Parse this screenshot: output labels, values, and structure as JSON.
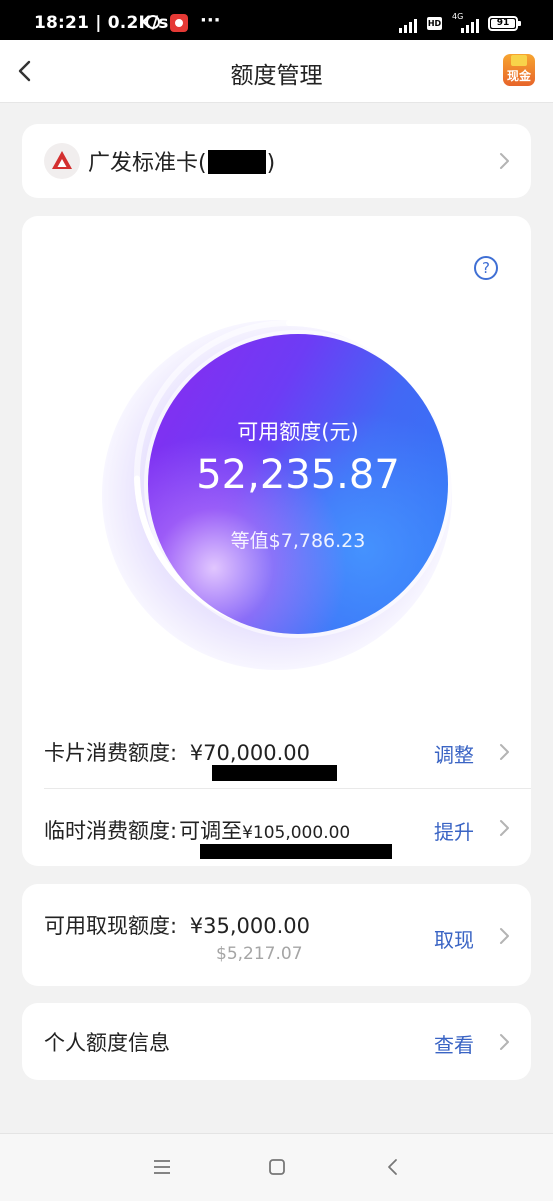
{
  "status_bar": {
    "time_speed": "18:21 | 0.2K/s",
    "more_dots": "···",
    "hd": "HD",
    "network": "4G",
    "battery": "91"
  },
  "navbar": {
    "title": "额度管理",
    "cash_label": "现金"
  },
  "bank_card": {
    "name_prefix": "广发标准卡(",
    "name_suffix": ")"
  },
  "credit": {
    "label": "可用额度(元)",
    "amount": "52,235.87",
    "usd": "等值$7,786.23",
    "help": "?",
    "available_fraction": 0.746
  },
  "limits": {
    "card": {
      "label": "卡片消费额度:",
      "value": "¥70,000.00",
      "action": "调整"
    },
    "temp": {
      "label": "临时消费额度:",
      "value_prefix": "可调至",
      "value": "¥105,000.00",
      "action": "提升"
    }
  },
  "cash": {
    "label": "可用取现额度:",
    "value": "¥35,000.00",
    "usd": "$5,217.07",
    "action": "取现"
  },
  "personal": {
    "label": "个人额度信息",
    "action": "查看"
  },
  "colors": {
    "accent_blue": "#3a64c4",
    "bank_red": "#d32f2f"
  }
}
